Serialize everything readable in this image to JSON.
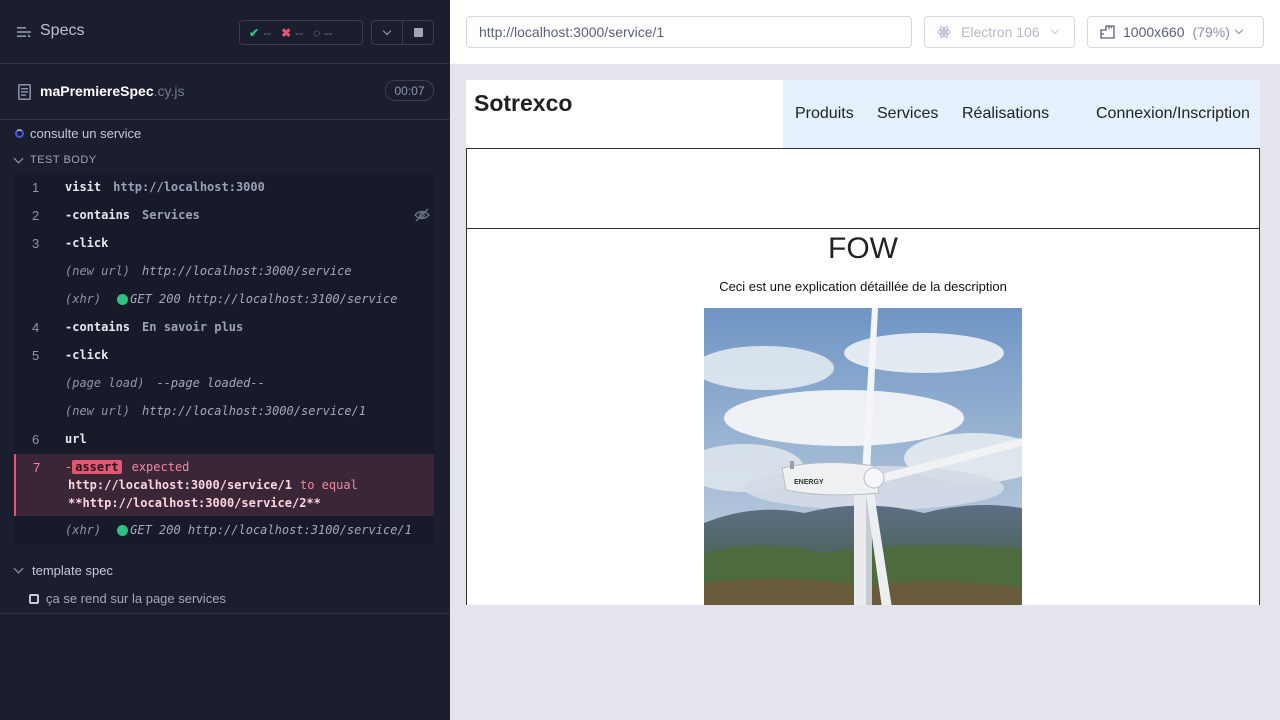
{
  "runner": {
    "specs_title": "Specs",
    "stats": {
      "passed": "--",
      "failed": "--",
      "pending": "--"
    },
    "colors": {
      "pass": "#2ec27e",
      "fail": "#e45770",
      "panel_bg": "#1b1e2e"
    }
  },
  "spec_file": {
    "name": "maPremiereSpec",
    "ext": ".cy.js",
    "duration": "00:07"
  },
  "suite": {
    "title": "consulte un service",
    "body_label": "TEST BODY"
  },
  "commands": [
    {
      "num": "1",
      "name": "visit",
      "arg": "http://localhost:3000"
    },
    {
      "num": "2",
      "name": "-contains",
      "arg": "Services"
    },
    {
      "num": "3",
      "name": "-click",
      "arg": ""
    },
    {
      "event": "(new url)",
      "value": "http://localhost:3000/service"
    },
    {
      "event": "(xhr)",
      "value": "GET 200 http://localhost:3100/service"
    },
    {
      "num": "4",
      "name": "-contains",
      "arg": "En savoir plus"
    },
    {
      "num": "5",
      "name": "-click",
      "arg": ""
    },
    {
      "event": "(page load)",
      "value": "--page loaded--"
    },
    {
      "event": "(new url)",
      "value": "http://localhost:3000/service/1"
    },
    {
      "num": "6",
      "name": "url",
      "arg": ""
    }
  ],
  "assertion": {
    "num": "7",
    "dash": "-",
    "badge": "assert",
    "expected_label": "expected",
    "actual": "http://localhost:3000/service/1",
    "to_equal": "to equal",
    "expected": "**http://localhost:3000/service/2**"
  },
  "after_assert": {
    "event": "(xhr)",
    "value": "GET 200 http://localhost:3100/service/1"
  },
  "template_suite": {
    "title": "template spec",
    "test": "ça se rend sur la page services"
  },
  "topbar": {
    "url": "http://localhost:3000/service/1",
    "browser": "Electron 106",
    "viewport": "1000x660",
    "scale": "(79%)"
  },
  "app": {
    "brand": "Sotrexco",
    "nav": [
      "Produits",
      "Services",
      "Réalisations",
      "Connexion/Inscription"
    ],
    "service_title": "FOW",
    "service_desc": "Ceci est une explication détaillée de la description",
    "photo_label": "ENERGY"
  }
}
